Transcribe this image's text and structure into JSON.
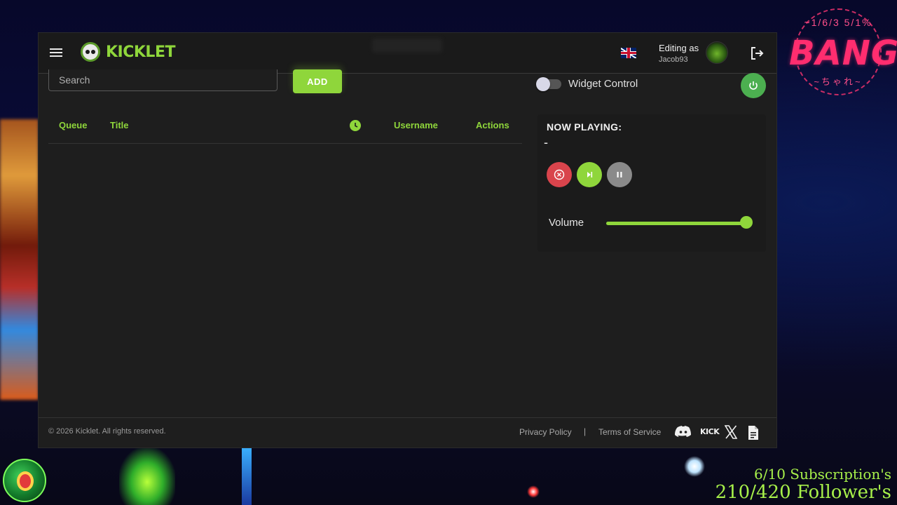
{
  "background": {
    "brand": {
      "top_text": "~1/6/3 5/1%",
      "main_text": "BANG",
      "bottom_text": "~ちゃれ~"
    },
    "stats": {
      "subscriptions": "6/10 Subscription's",
      "followers": "210/420 Follower's"
    }
  },
  "header": {
    "menu_icon": "hamburger-icon",
    "logo_text": "KICKLET",
    "language_icon": "uk-flag-icon",
    "editing_label": "Editing as",
    "username": "Jacob93",
    "logout_icon": "logout-icon"
  },
  "queue": {
    "search_placeholder": "Search",
    "add_label": "ADD",
    "columns": [
      "Queue",
      "Title",
      "clock-icon",
      "Username",
      "Actions"
    ],
    "rows": []
  },
  "widget": {
    "toggle_label": "Widget Control",
    "toggle_on": false,
    "now_playing_label": "NOW PLAYING:",
    "now_playing_track": "-",
    "controls": [
      "stop-icon",
      "skip-icon",
      "pause-icon"
    ],
    "volume_label": "Volume",
    "volume_level": 1.0
  },
  "footer": {
    "copyright": "© 2026 Kicklet. All rights reserved.",
    "privacy": "Privacy Policy",
    "separator": "|",
    "terms": "Terms of Service",
    "kick_label": "KICK",
    "social_icons": [
      "discord-icon",
      "kick-icon",
      "x-icon",
      "document-icon"
    ]
  },
  "colors": {
    "accent": "#8fd63b",
    "stop": "#d9444c",
    "power": "#4caf50",
    "surface": "#1e1e1e"
  }
}
